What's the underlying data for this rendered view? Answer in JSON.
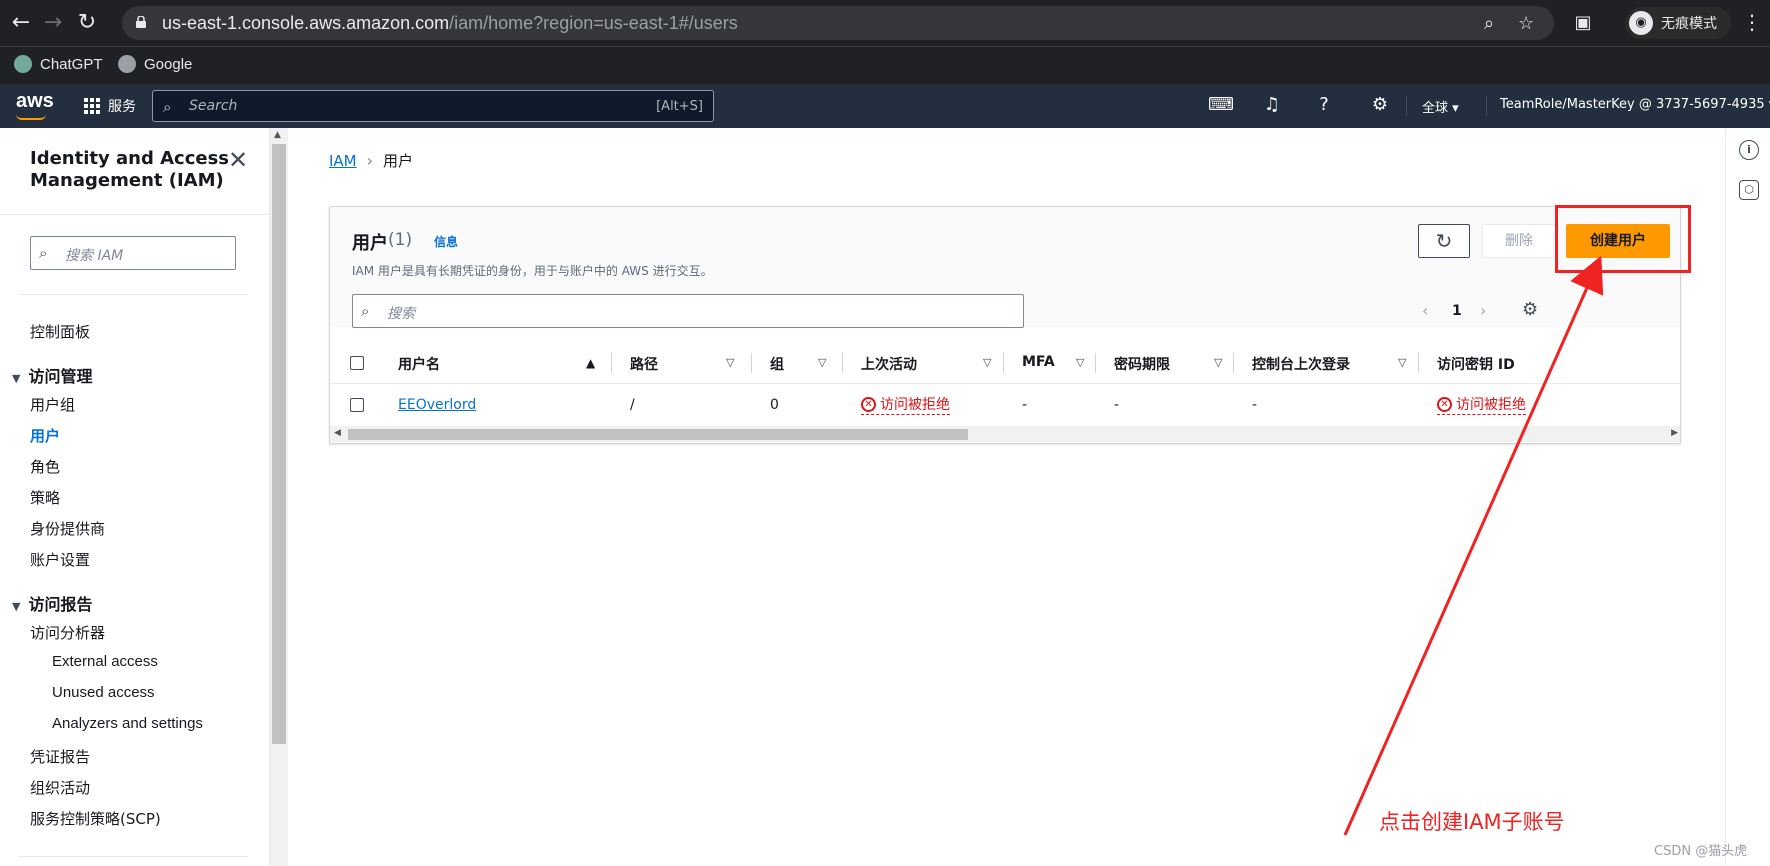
{
  "browser": {
    "url_host": "us-east-1.console.aws.amazon.com",
    "url_path": "/iam/home?region=us-east-1#/users",
    "profile_label": "无痕模式",
    "bookmarks": [
      {
        "label": "ChatGPT"
      },
      {
        "label": "Google"
      }
    ]
  },
  "aws_header": {
    "logo": "aws",
    "services_label": "服务",
    "search_placeholder": "Search",
    "search_shortcut": "[Alt+S]",
    "region_label": "全球 ▾",
    "account_label": "TeamRole/MasterKey @ 3737-5697-4935 ▾"
  },
  "sidebar": {
    "title": "Identity and Access Management (IAM)",
    "search_placeholder": "搜索 IAM",
    "dashboard": "控制面板",
    "access_management": {
      "label": "访问管理",
      "items": [
        "用户组",
        "用户",
        "角色",
        "策略",
        "身份提供商",
        "账户设置"
      ],
      "active": "用户"
    },
    "access_reports": {
      "label": "访问报告",
      "items": [
        "访问分析器"
      ],
      "subitems": [
        "External access",
        "Unused access",
        "Analyzers and settings"
      ],
      "more": [
        "凭证报告",
        "组织活动",
        "服务控制策略(SCP)"
      ]
    }
  },
  "breadcrumb": {
    "root": "IAM",
    "current": "用户"
  },
  "users_panel": {
    "title": "用户",
    "count": "(1)",
    "info_link": "信息",
    "description": "IAM 用户是具有长期凭证的身份，用于与账户中的 AWS 进行交互。",
    "delete_label": "删除",
    "create_label": "创建用户",
    "search_placeholder": "搜索",
    "page": "1",
    "columns": [
      "用户名",
      "路径",
      "组",
      "上次活动",
      "MFA",
      "密码期限",
      "控制台上次登录",
      "访问密钥 ID"
    ],
    "rows": [
      {
        "username": "EEOverlord",
        "path": "/",
        "groups": "0",
        "last_activity": "访问被拒绝",
        "mfa": "-",
        "password_age": "-",
        "console_last_signin": "-",
        "access_key_id": "访问被拒绝"
      }
    ]
  },
  "annotation": {
    "text": "点击创建IAM子账号",
    "color": "#f02222"
  },
  "watermark": "CSDN @猫头虎",
  "colors": {
    "aws_nav": "#232f3e",
    "primary_button": "#ff9900",
    "link": "#0972d3",
    "error": "#d91515"
  }
}
